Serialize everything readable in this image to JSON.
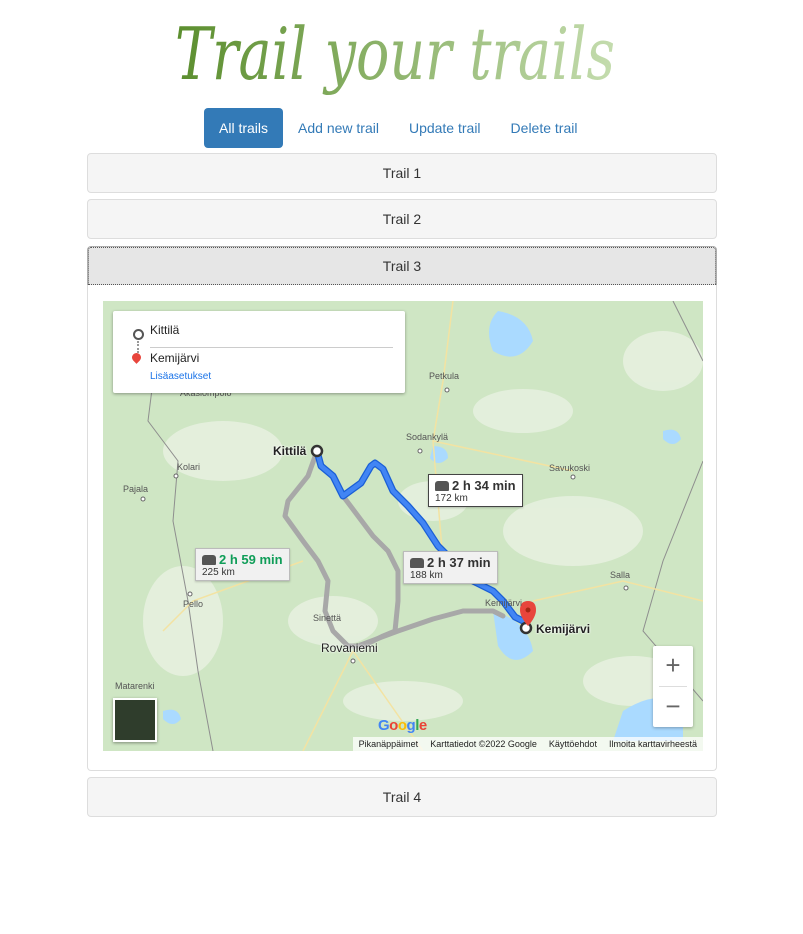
{
  "header": {
    "logo_text": "Trail your trails"
  },
  "nav": {
    "tabs": [
      "All trails",
      "Add new trail",
      "Update trail",
      "Delete trail"
    ],
    "active": "All trails"
  },
  "trails": [
    "Trail 1",
    "Trail 2",
    "Trail 3",
    "Trail 4"
  ],
  "map": {
    "directions": {
      "origin": "Kittilä",
      "destination": "Kemijärvi",
      "more_options": "Lisäasetukset"
    },
    "routes": [
      {
        "duration": "2 h 34 min",
        "distance": "172 km",
        "selected": true
      },
      {
        "duration": "2 h 59 min",
        "distance": "225 km",
        "selected": false
      },
      {
        "duration": "2 h 37 min",
        "distance": "188 km",
        "selected": false
      }
    ],
    "places": [
      "Petkula",
      "Akäslompolo",
      "Sodankylä",
      "Savukoski",
      "Kolari",
      "Pajala",
      "Pello",
      "Sinettä",
      "Kemijärvi",
      "Salla",
      "Matarenki"
    ],
    "cities": {
      "start": "Kittilä",
      "end": "Kemijärvi",
      "rovaniemi": "Rovaniemi"
    },
    "zoom": {
      "in": "+",
      "out": "−"
    },
    "google_logo": "Google",
    "footer": [
      "Pikanäppäimet",
      "Karttatiedot ©2022 Google",
      "Käyttöehdot",
      "Ilmoita karttavirheestä"
    ],
    "colors": {
      "selected_route": "#4285f4",
      "alt_route": "#a8a8a8",
      "water": "#aadaff",
      "land": "#cfe6c4"
    }
  }
}
